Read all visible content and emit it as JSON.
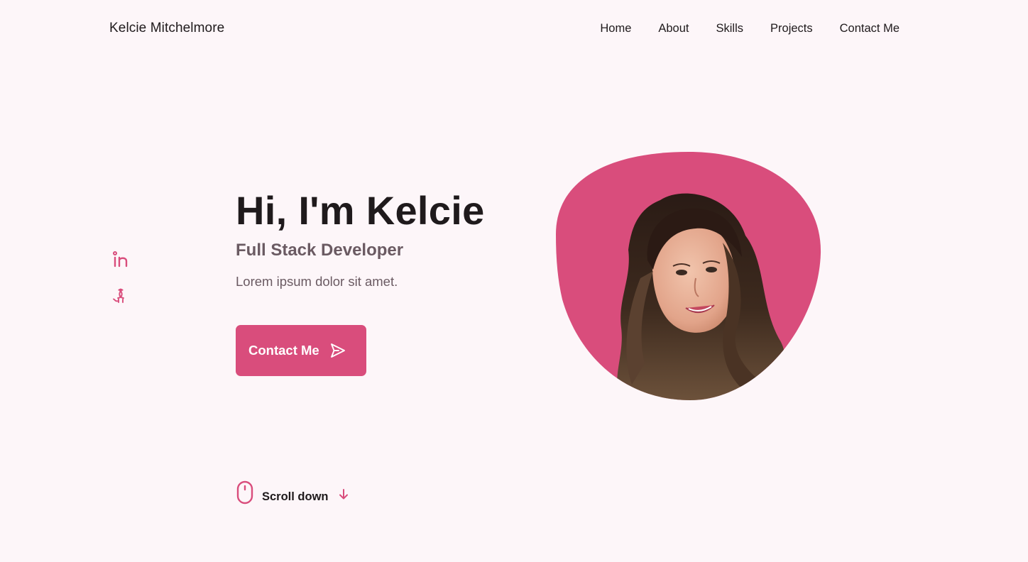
{
  "header": {
    "logo": "Kelcie Mitchelmore",
    "nav": [
      "Home",
      "About",
      "Skills",
      "Projects",
      "Contact Me"
    ]
  },
  "social": {
    "icons": [
      "linkedin-icon",
      "github-icon"
    ]
  },
  "hero": {
    "title": "Hi, I'm Kelcie",
    "subtitle": "Full Stack Developer",
    "description": "Lorem ipsum dolor sit amet.",
    "button_label": "Contact Me",
    "button_icon": "send-icon"
  },
  "scroll": {
    "label": "Scroll down",
    "icons": [
      "mouse-icon",
      "arrow-down-icon"
    ]
  },
  "colors": {
    "accent": "#d94d7c",
    "background": "#fdf6f9",
    "text": "#1f1a1c",
    "muted": "#6a5a62"
  }
}
